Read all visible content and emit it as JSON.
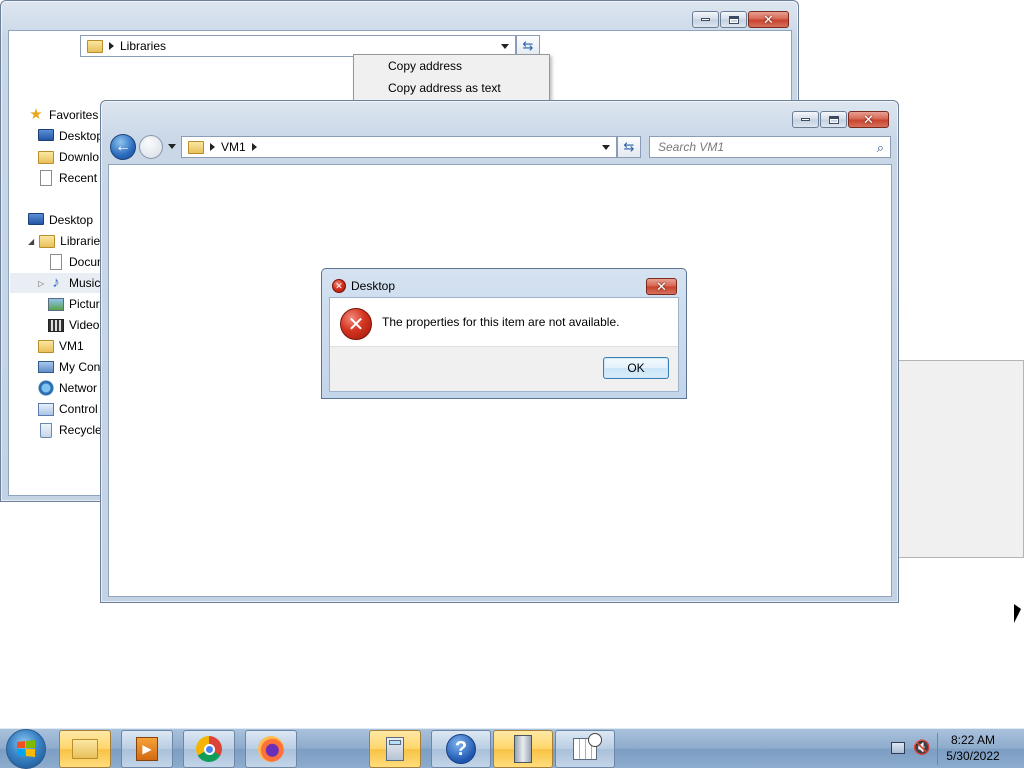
{
  "back_window": {
    "address_path": "Libraries",
    "context_menu": [
      "Copy address",
      "Copy address as text"
    ],
    "nav": {
      "favorites_label": "Favorites",
      "favorites_items": [
        "Desktop",
        "Downlo",
        "Recent I"
      ],
      "desktop_label": "Desktop",
      "libraries_label": "Libraries",
      "library_items": [
        "Docum",
        "Music",
        "Pictur",
        "Video"
      ],
      "other_items": [
        "VM1",
        "My Con",
        "Networ",
        "Control",
        "Recycle"
      ]
    }
  },
  "front_window": {
    "address_path": "VM1",
    "search_placeholder": "Search VM1"
  },
  "dialog": {
    "title": "Desktop",
    "message": "The properties for this item are not available.",
    "ok_label": "OK"
  },
  "taskbar": {
    "time": "8:22 AM",
    "date": "5/30/2022",
    "buttons": [
      "windows-explorer",
      "media-player",
      "chrome",
      "firefox",
      "calculator",
      "help",
      "file-server",
      "task-scheduler"
    ]
  },
  "colors": {
    "accent": "#3a83c6",
    "error": "#d5341f",
    "taskbar": "#8eabcb"
  }
}
